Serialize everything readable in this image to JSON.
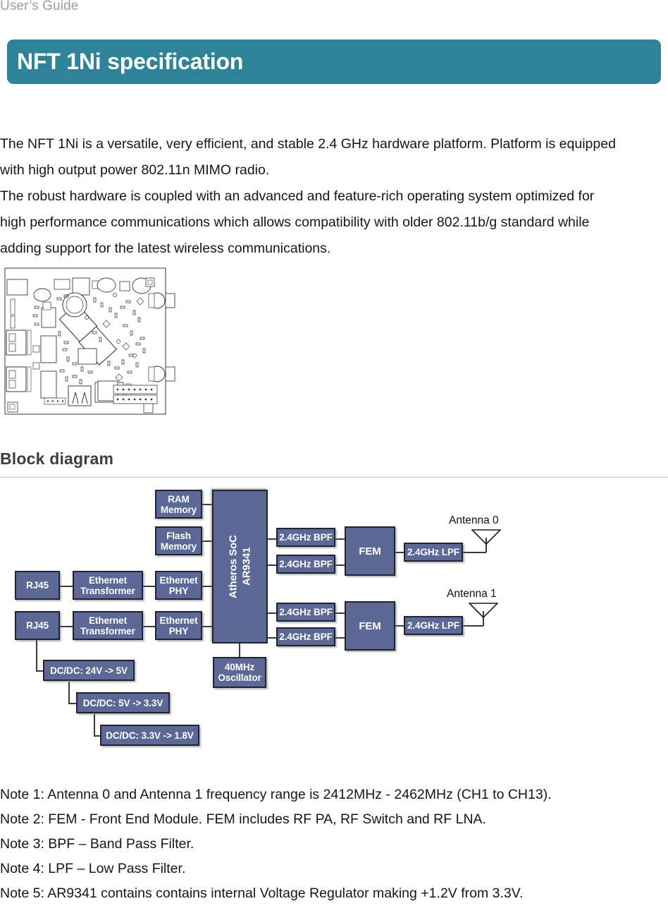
{
  "header": {
    "running_title": "User’s Guide"
  },
  "banner": {
    "title": "NFT 1Ni specification",
    "bg_color": "#2f8399",
    "text_color": "#ffffff"
  },
  "intro": {
    "paragraphs": [
      "The NFT 1Ni is a versatile, very efficient, and stable 2.4 GHz hardware platform. Platform is equipped",
      "with high output power 802.11n MIMO radio.",
      "The robust hardware is coupled with an advanced and feature-rich operating system optimized for",
      "high performance communications which allows compatibility with older 802.11b/g standard while",
      "adding support for the latest wireless communications."
    ]
  },
  "figure": {
    "caption": "",
    "alt": "PCB top-view layout line drawing of the NFT 1Ni board"
  },
  "section": {
    "heading": "Block diagram"
  },
  "diagram": {
    "block_fill": "#5c6896",
    "block_border": "#21242e",
    "blocks": {
      "ram_memory": "RAM\nMemory",
      "flash_memory": "Flash\nMemory",
      "ethernet_phy_0": "Ethernet\nPHY",
      "ethernet_phy_1": "Ethernet\nPHY",
      "ethernet_transformer_0": "Ethernet\nTransformer",
      "ethernet_transformer_1": "Ethernet\nTransformer",
      "rj45_0": "RJ45",
      "rj45_1": "RJ45",
      "soc": "Atheros SoC\nAR9341",
      "oscillator": "40MHz\nOscillator",
      "bpf_0": "2.4GHz BPF",
      "bpf_1": "2.4GHz BPF",
      "bpf_2": "2.4GHz BPF",
      "bpf_3": "2.4GHz BPF",
      "fem_0": "FEM",
      "fem_1": "FEM",
      "lpf_0": "2.4GHz LPF",
      "lpf_1": "2.4GHz LPF",
      "dcdc_24_5": "DC/DC: 24V -> 5V",
      "dcdc_5_33": "DC/DC: 5V -> 3.3V",
      "dcdc_33_18": "DC/DC: 3.3V -> 1.8V"
    },
    "labels": {
      "antenna_0": "Antenna 0",
      "antenna_1": "Antenna 1"
    }
  },
  "notes": {
    "items": [
      "Note 1: Antenna 0 and Antenna 1 frequency range is 2412MHz - 2462MHz (CH1 to CH13).",
      "Note 2: FEM - Front End Module. FEM includes RF PA, RF Switch and RF LNA.",
      "Note 3: BPF – Band Pass Filter.",
      "Note 4: LPF – Low Pass Filter.",
      "Note 5: AR9341 contains contains internal Voltage Regulator making +1.2V from 3.3V."
    ]
  }
}
